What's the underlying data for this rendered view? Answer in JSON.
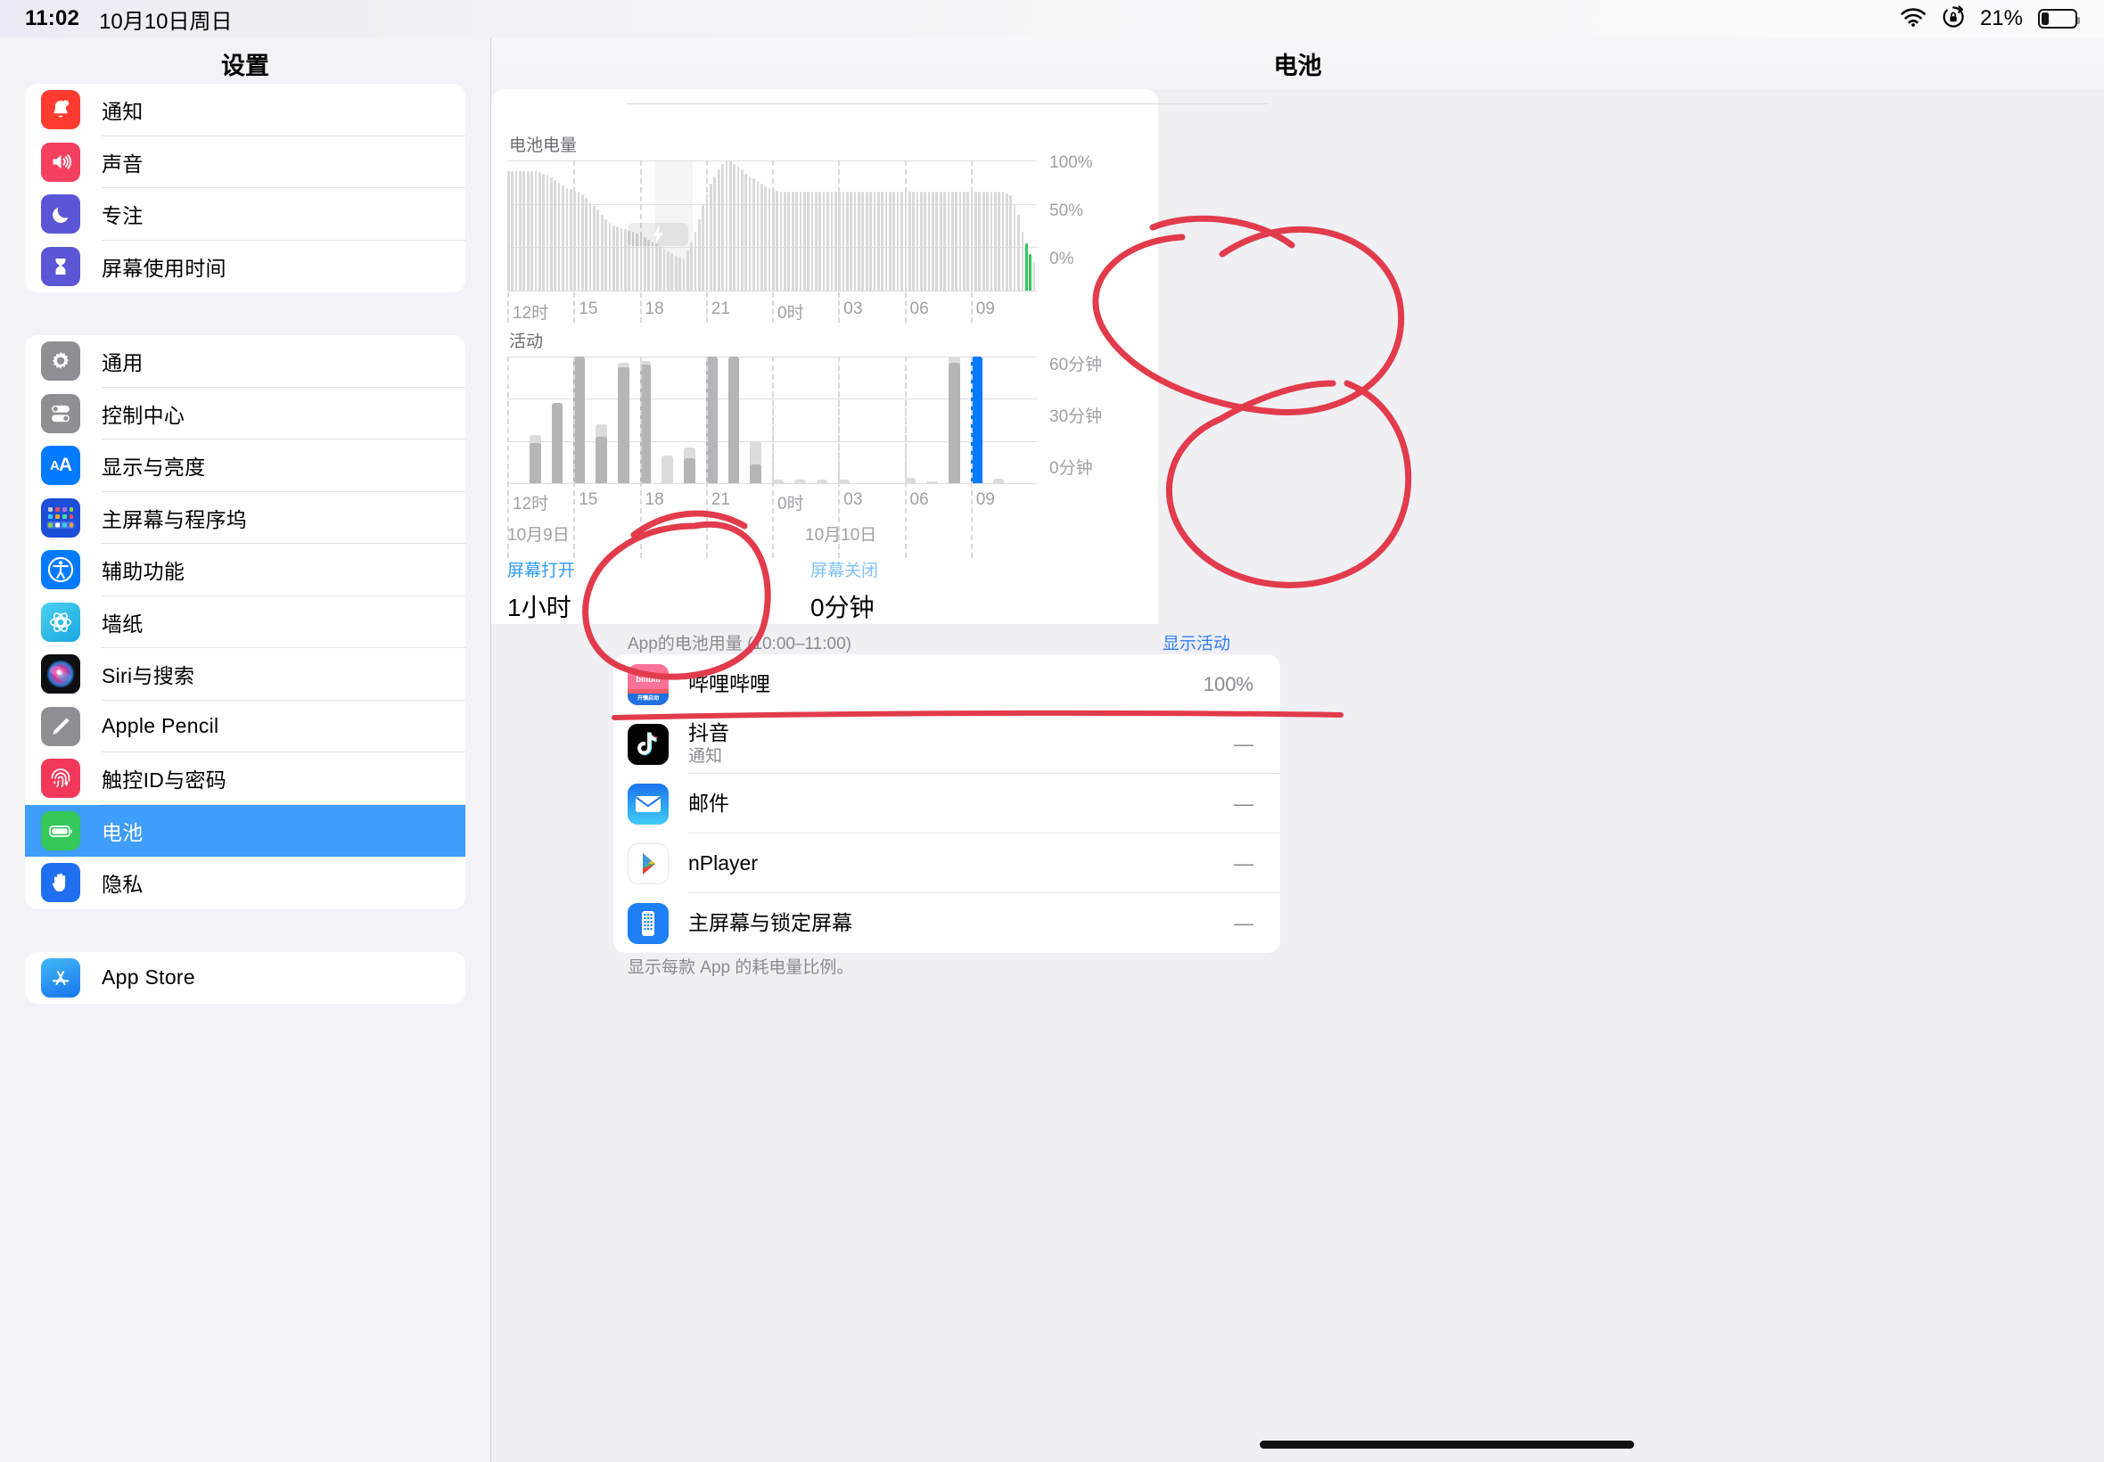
{
  "status_bar": {
    "time": "11:02",
    "date": "10月10日周日",
    "battery_percent": "21%",
    "wifi_icon": "wifi-icon",
    "rotation_lock_icon": "rotation-lock-icon",
    "battery_icon": "battery-icon"
  },
  "sidebar": {
    "title": "设置",
    "groups": [
      {
        "items": [
          {
            "label": "通知",
            "icon": "bell-icon",
            "name": "notifications"
          },
          {
            "label": "声音",
            "icon": "speaker-icon",
            "name": "sounds"
          },
          {
            "label": "专注",
            "icon": "moon-icon",
            "name": "focus"
          },
          {
            "label": "屏幕使用时间",
            "icon": "hourglass-icon",
            "name": "screen-time"
          }
        ]
      },
      {
        "items": [
          {
            "label": "通用",
            "icon": "gear-icon",
            "name": "general"
          },
          {
            "label": "控制中心",
            "icon": "toggles-icon",
            "name": "control-center"
          },
          {
            "label": "显示与亮度",
            "icon": "aa-icon",
            "name": "display-brightness"
          },
          {
            "label": "主屏幕与程序坞",
            "icon": "appgrid-icon",
            "name": "home-screen-dock"
          },
          {
            "label": "辅助功能",
            "icon": "accessibility-icon",
            "name": "accessibility"
          },
          {
            "label": "墙纸",
            "icon": "wallpaper-icon",
            "name": "wallpaper"
          },
          {
            "label": "Siri与搜索",
            "icon": "siri-icon",
            "name": "siri-search"
          },
          {
            "label": "Apple Pencil",
            "icon": "pencil-icon",
            "name": "apple-pencil"
          },
          {
            "label": "触控ID与密码",
            "icon": "fingerprint-icon",
            "name": "touch-id-passcode"
          },
          {
            "label": "电池",
            "icon": "battery-green-icon",
            "name": "battery",
            "selected": true
          },
          {
            "label": "隐私",
            "icon": "hand-icon",
            "name": "privacy"
          }
        ]
      },
      {
        "items": [
          {
            "label": "App Store",
            "icon": "appstore-icon",
            "name": "app-store"
          }
        ]
      }
    ]
  },
  "detail": {
    "title": "电池",
    "usage": {
      "screen_on_label": "屏幕打开",
      "screen_on_value": "1小时",
      "screen_off_label": "屏幕关闭",
      "screen_off_value": "0分钟"
    },
    "app_usage_header": "App的电池用量 (10:00–11:00)",
    "show_activity_link": "显示活动",
    "apps": [
      {
        "name": "哔哩哔哩",
        "subtitle": "",
        "value": "100%",
        "icon": "bilibili-icon"
      },
      {
        "name": "抖音",
        "subtitle": "通知",
        "value": "—",
        "icon": "douyin-icon"
      },
      {
        "name": "邮件",
        "subtitle": "",
        "value": "—",
        "icon": "mail-icon"
      },
      {
        "name": "nPlayer",
        "subtitle": "",
        "value": "—",
        "icon": "nplayer-icon"
      },
      {
        "name": "主屏幕与锁定屏幕",
        "subtitle": "",
        "value": "—",
        "icon": "homescreen-icon"
      }
    ],
    "footnote": "显示每款 App 的耗电量比例。"
  },
  "annotation": {
    "color": "#e23b4b",
    "marks": [
      "ellipse-around-battery-green-bars",
      "ellipse-around-activity-blue-bar",
      "ellipse-around-screen-on-1hour",
      "underline-under-bilibili-row"
    ]
  },
  "chart_data": [
    {
      "type": "bar",
      "name": "battery-level-chart",
      "title": "电池电量",
      "ylabel": "",
      "ylim": [
        0,
        100
      ],
      "ytick_labels": [
        "100%",
        "50%",
        "0%"
      ],
      "ytick_values": [
        100,
        50,
        0
      ],
      "xlabel": "",
      "xtick_labels": [
        "12时",
        "15",
        "18",
        "21",
        "0时",
        "03",
        "06",
        "09"
      ],
      "xtick_hours": [
        12,
        15,
        18,
        21,
        0,
        3,
        6,
        9
      ],
      "grid": true,
      "bar_color_past": "#d9d9db",
      "bar_color_current": "#34c759",
      "charging_band": {
        "start_hour": 18.7,
        "end_hour": 20.4,
        "bolt_icon": "bolt-icon"
      },
      "values": [
        92,
        92,
        92,
        92,
        92,
        92,
        92,
        92,
        91,
        90,
        89,
        87,
        85,
        83,
        81,
        79,
        78,
        77,
        76,
        74,
        71,
        68,
        65,
        62,
        58,
        55,
        52,
        50,
        49,
        48,
        47,
        46,
        45,
        44,
        43,
        41,
        39,
        38,
        36,
        34,
        32,
        30,
        29,
        27,
        26,
        25,
        31,
        38,
        45,
        55,
        66,
        74,
        82,
        88,
        93,
        97,
        100,
        99,
        97,
        95,
        93,
        90,
        88,
        86,
        84,
        82,
        80,
        79,
        78,
        77,
        76,
        76,
        76,
        76,
        76,
        76,
        76,
        76,
        76,
        76,
        76,
        76,
        76,
        76,
        76,
        76,
        76,
        76,
        76,
        76,
        76,
        76,
        76,
        76,
        76,
        76,
        76,
        76,
        76,
        76,
        76,
        76,
        76,
        76,
        76,
        76,
        76,
        76,
        76,
        76,
        76,
        76,
        76,
        76,
        76,
        76,
        76,
        76,
        76,
        76,
        76,
        76,
        76,
        76,
        76,
        76,
        76,
        76,
        75,
        73,
        66,
        58,
        45,
        36,
        28,
        22
      ],
      "highlighted_values": [
        45,
        36,
        28
      ],
      "current_value": 22
    },
    {
      "type": "bar",
      "name": "activity-chart",
      "title": "活动",
      "ylabel": "",
      "ylim": [
        0,
        60
      ],
      "ytick_labels": [
        "60分钟",
        "30分钟",
        "0分钟"
      ],
      "ytick_values": [
        60,
        30,
        0
      ],
      "xlabel": "",
      "xtick_labels": [
        "12时",
        "15",
        "18",
        "21",
        "0时",
        "03",
        "06",
        "09"
      ],
      "date_labels": [
        "10月9日",
        "10月10日"
      ],
      "grid": true,
      "bar_color_screen_on": "#b5b5b8",
      "bar_color_screen_off": "#dcdcdf",
      "bar_color_current": "#007aff",
      "categories": [
        "12",
        "13",
        "14",
        "15",
        "16",
        "17",
        "18",
        "19",
        "20",
        "21",
        "22",
        "23",
        "0",
        "1",
        "2",
        "3",
        "4",
        "5",
        "6",
        "7",
        "8",
        "9",
        "10",
        "11"
      ],
      "series": [
        {
          "name": "屏幕打开",
          "values": [
            0,
            19,
            38,
            60,
            22,
            55,
            56,
            0,
            12,
            60,
            60,
            9,
            0,
            0,
            0,
            0,
            0,
            0,
            0,
            0,
            57,
            60,
            0,
            0
          ]
        },
        {
          "name": "屏幕关闭",
          "values": [
            0,
            4,
            0,
            0,
            6,
            2,
            2,
            13,
            5,
            0,
            0,
            11,
            1.5,
            1.5,
            1.5,
            1.5,
            0,
            0,
            2.5,
            1,
            3,
            0,
            2,
            0
          ]
        }
      ],
      "current_bar_index": 21,
      "current_bar_value": 60
    }
  ]
}
